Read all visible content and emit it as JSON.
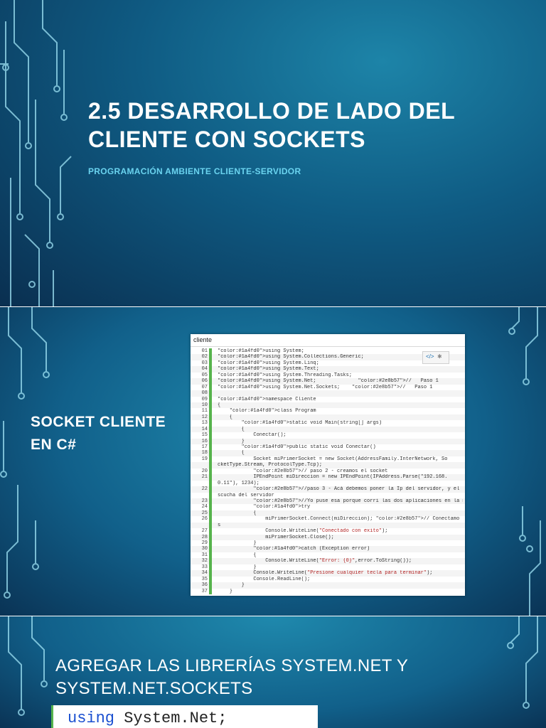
{
  "slide1": {
    "title": "2.5 DESARROLLO DE LADO DEL CLIENTE CON SOCKETS",
    "subtitle": "PROGRAMACIÓN AMBIENTE CLIENTE-SERVIDOR"
  },
  "slide2": {
    "title": "SOCKET CLIENTE EN C#",
    "code_header": "cliente",
    "code_lines": [
      {
        "n": "01",
        "t": "using System;"
      },
      {
        "n": "02",
        "t": "using System.Collections.Generic;"
      },
      {
        "n": "03",
        "t": "using System.Linq;"
      },
      {
        "n": "04",
        "t": "using System.Text;"
      },
      {
        "n": "05",
        "t": "using System.Threading.Tasks;"
      },
      {
        "n": "06",
        "t": "using System.Net;              //   Paso 1"
      },
      {
        "n": "07",
        "t": "using System.Net.Sockets;    //   Paso 1"
      },
      {
        "n": "08",
        "t": ""
      },
      {
        "n": "09",
        "t": "namespace Cliente"
      },
      {
        "n": "10",
        "t": "{"
      },
      {
        "n": "11",
        "t": "    class Program"
      },
      {
        "n": "12",
        "t": "    {"
      },
      {
        "n": "13",
        "t": "        static void Main(string[] args)"
      },
      {
        "n": "14",
        "t": "        {"
      },
      {
        "n": "15",
        "t": "            Conectar();"
      },
      {
        "n": "16",
        "t": "        }"
      },
      {
        "n": "17",
        "t": "        public static void Conectar()"
      },
      {
        "n": "18",
        "t": "        {"
      },
      {
        "n": "19",
        "t": "            Socket miPrimerSocket = new Socket(AddressFamily.InterNetwork, So"
      },
      {
        "n": "",
        "t": "cketType.Stream, ProtocolType.Tcp);"
      },
      {
        "n": "20",
        "t": "            // paso 2 - creamos el socket"
      },
      {
        "n": "21",
        "t": "            IPEndPoint miDireccion = new IPEndPoint(IPAddress.Parse(\"192.168."
      },
      {
        "n": "",
        "t": "0.11\"), 1234);"
      },
      {
        "n": "22",
        "t": "            //paso 3 - Acá debemos poner la Ip del servidor, y el puerto de e"
      },
      {
        "n": "",
        "t": "scucha del servidor"
      },
      {
        "n": "23",
        "t": "            //Yo puse esa porque corri las dos aplicaciones en la misma pc"
      },
      {
        "n": "24",
        "t": "            try"
      },
      {
        "n": "25",
        "t": "            {"
      },
      {
        "n": "26",
        "t": "                miPrimerSocket.Connect(miDireccion); // Conectamo"
      },
      {
        "n": "",
        "t": "s"
      },
      {
        "n": "27",
        "t": "                Console.WriteLine(\"Conectado con exito\");"
      },
      {
        "n": "28",
        "t": "                miPrimerSocket.Close();"
      },
      {
        "n": "29",
        "t": "            }"
      },
      {
        "n": "30",
        "t": "            catch (Exception error)"
      },
      {
        "n": "31",
        "t": "            {"
      },
      {
        "n": "32",
        "t": "                Console.WriteLine(\"Error: {0}\",error.ToString());"
      },
      {
        "n": "33",
        "t": "            }"
      },
      {
        "n": "34",
        "t": "            Console.WriteLine(\"Presione cualquier tecla para terminar\");"
      },
      {
        "n": "35",
        "t": "            Console.ReadLine();"
      },
      {
        "n": "36",
        "t": "        }"
      },
      {
        "n": "37",
        "t": "    }"
      }
    ]
  },
  "slide3": {
    "title": "AGREGAR LAS LIBRERÍAS SYSTEM.NET Y SYSTEM.NET.SOCKETS",
    "code_keyword": "using",
    "code_rest": " System.Net;"
  }
}
